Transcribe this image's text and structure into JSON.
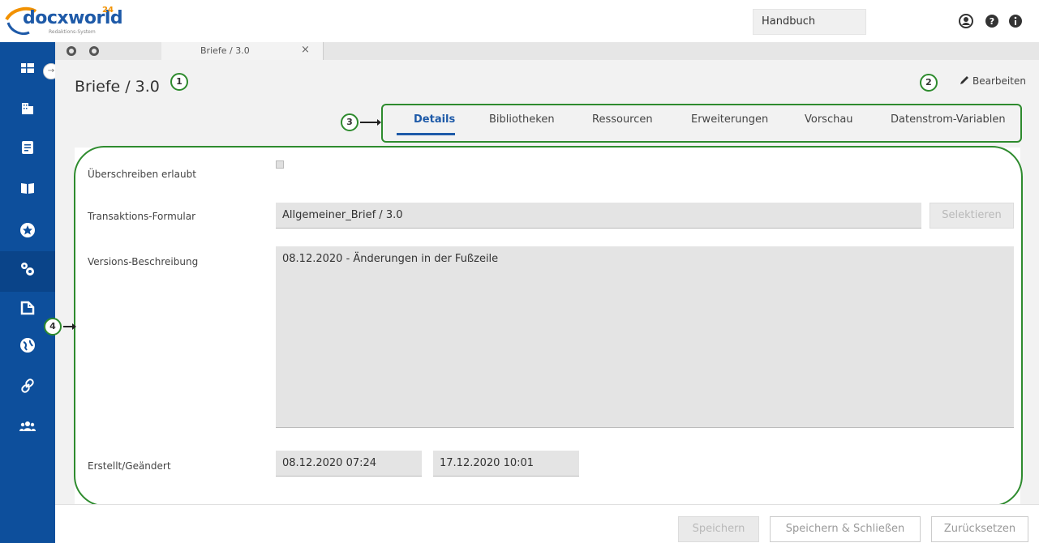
{
  "header": {
    "logo_text_main": "docxworld",
    "logo_sup": "24",
    "logo_subtitle": "Redaktions-System",
    "search_value": "Handbuch"
  },
  "tabbar": {
    "doc_tab_label": "Briefe / 3.0",
    "doc_tab_close": "×"
  },
  "page": {
    "title": "Briefe / 3.0",
    "edit_label": "Bearbeiten"
  },
  "callouts": [
    "1",
    "2",
    "3",
    "4"
  ],
  "nav_tabs": [
    {
      "label": "Details",
      "active": true
    },
    {
      "label": "Bibliotheken",
      "active": false
    },
    {
      "label": "Ressourcen",
      "active": false
    },
    {
      "label": "Erweiterungen",
      "active": false
    },
    {
      "label": "Vorschau",
      "active": false
    },
    {
      "label": "Datenstrom-Variablen",
      "active": false
    }
  ],
  "form": {
    "overwrite_label": "Überschreiben erlaubt",
    "overwrite_checked": true,
    "transaction_label": "Transaktions-Formular",
    "transaction_value": "Allgemeiner_Brief / 3.0",
    "select_button": "Selektieren",
    "description_label": "Versions-Beschreibung",
    "description_value": "08.12.2020 - Änderungen in der Fußzeile",
    "created_label": "Erstellt/Geändert",
    "created_value": "08.12.2020 07:24",
    "changed_value": "17.12.2020 10:01"
  },
  "footer": {
    "save": "Speichern",
    "save_close": "Speichern & Schließen",
    "reset": "Zurücksetzen"
  },
  "colors": {
    "sidebar": "#0d4f9c",
    "accent": "#1e5aa8",
    "callout_green": "#2e8b2e",
    "logo_orange": "#f29100"
  }
}
